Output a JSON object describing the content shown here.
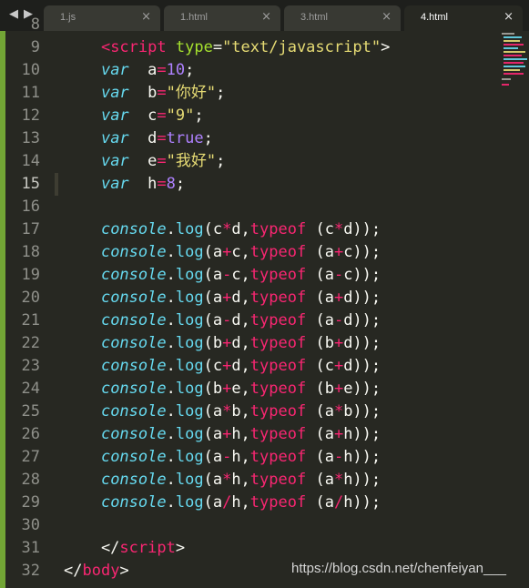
{
  "tabs": [
    {
      "label": "1.js",
      "active": false
    },
    {
      "label": "1.html",
      "active": false
    },
    {
      "label": "3.html",
      "active": false
    },
    {
      "label": "4.html",
      "active": true
    }
  ],
  "close_glyph": "×",
  "nav": {
    "back": "◀",
    "forward": "▶"
  },
  "line_numbers": [
    "8",
    "9",
    "10",
    "11",
    "12",
    "13",
    "14",
    "15",
    "16",
    "17",
    "18",
    "19",
    "20",
    "21",
    "22",
    "23",
    "24",
    "25",
    "26",
    "27",
    "28",
    "29",
    "30",
    "31",
    "32"
  ],
  "current_line": "15",
  "code_lines": [
    [
      [
        "plain",
        "    "
      ],
      [
        "tag",
        "<script"
      ],
      [
        "plain",
        " "
      ],
      [
        "attr",
        "type"
      ],
      [
        "plain",
        "="
      ],
      [
        "str",
        "\"text/javascript\""
      ],
      [
        "plain",
        ">"
      ]
    ],
    [
      [
        "plain",
        "    "
      ],
      [
        "kw",
        "var"
      ],
      [
        "plain",
        "  a"
      ],
      [
        "op",
        "="
      ],
      [
        "num",
        "10"
      ],
      [
        "plain",
        ";"
      ]
    ],
    [
      [
        "plain",
        "    "
      ],
      [
        "kw",
        "var"
      ],
      [
        "plain",
        "  b"
      ],
      [
        "op",
        "="
      ],
      [
        "str",
        "\"你好\""
      ],
      [
        "plain",
        ";"
      ]
    ],
    [
      [
        "plain",
        "    "
      ],
      [
        "kw",
        "var"
      ],
      [
        "plain",
        "  c"
      ],
      [
        "op",
        "="
      ],
      [
        "str",
        "\"9\""
      ],
      [
        "plain",
        ";"
      ]
    ],
    [
      [
        "plain",
        "    "
      ],
      [
        "kw",
        "var"
      ],
      [
        "plain",
        "  d"
      ],
      [
        "op",
        "="
      ],
      [
        "num",
        "true"
      ],
      [
        "plain",
        ";"
      ]
    ],
    [
      [
        "plain",
        "    "
      ],
      [
        "kw",
        "var"
      ],
      [
        "plain",
        "  e"
      ],
      [
        "op",
        "="
      ],
      [
        "str",
        "\"我好\""
      ],
      [
        "plain",
        ";"
      ]
    ],
    [
      [
        "plain",
        "    "
      ],
      [
        "kw",
        "var"
      ],
      [
        "plain",
        "  h"
      ],
      [
        "op",
        "="
      ],
      [
        "num",
        "8"
      ],
      [
        "plain",
        ";"
      ]
    ],
    [],
    [
      [
        "plain",
        "    "
      ],
      [
        "obj",
        "console"
      ],
      [
        "plain",
        "."
      ],
      [
        "fn",
        "log"
      ],
      [
        "plain",
        "(c"
      ],
      [
        "op",
        "*"
      ],
      [
        "plain",
        "d,"
      ],
      [
        "op",
        "typeof"
      ],
      [
        "plain",
        " (c"
      ],
      [
        "op",
        "*"
      ],
      [
        "plain",
        "d));"
      ]
    ],
    [
      [
        "plain",
        "    "
      ],
      [
        "obj",
        "console"
      ],
      [
        "plain",
        "."
      ],
      [
        "fn",
        "log"
      ],
      [
        "plain",
        "(a"
      ],
      [
        "op",
        "+"
      ],
      [
        "plain",
        "c,"
      ],
      [
        "op",
        "typeof"
      ],
      [
        "plain",
        " (a"
      ],
      [
        "op",
        "+"
      ],
      [
        "plain",
        "c));"
      ]
    ],
    [
      [
        "plain",
        "    "
      ],
      [
        "obj",
        "console"
      ],
      [
        "plain",
        "."
      ],
      [
        "fn",
        "log"
      ],
      [
        "plain",
        "(a"
      ],
      [
        "op",
        "-"
      ],
      [
        "plain",
        "c,"
      ],
      [
        "op",
        "typeof"
      ],
      [
        "plain",
        " (a"
      ],
      [
        "op",
        "-"
      ],
      [
        "plain",
        "c));"
      ]
    ],
    [
      [
        "plain",
        "    "
      ],
      [
        "obj",
        "console"
      ],
      [
        "plain",
        "."
      ],
      [
        "fn",
        "log"
      ],
      [
        "plain",
        "(a"
      ],
      [
        "op",
        "+"
      ],
      [
        "plain",
        "d,"
      ],
      [
        "op",
        "typeof"
      ],
      [
        "plain",
        " (a"
      ],
      [
        "op",
        "+"
      ],
      [
        "plain",
        "d));"
      ]
    ],
    [
      [
        "plain",
        "    "
      ],
      [
        "obj",
        "console"
      ],
      [
        "plain",
        "."
      ],
      [
        "fn",
        "log"
      ],
      [
        "plain",
        "(a"
      ],
      [
        "op",
        "-"
      ],
      [
        "plain",
        "d,"
      ],
      [
        "op",
        "typeof"
      ],
      [
        "plain",
        " (a"
      ],
      [
        "op",
        "-"
      ],
      [
        "plain",
        "d));"
      ]
    ],
    [
      [
        "plain",
        "    "
      ],
      [
        "obj",
        "console"
      ],
      [
        "plain",
        "."
      ],
      [
        "fn",
        "log"
      ],
      [
        "plain",
        "(b"
      ],
      [
        "op",
        "+"
      ],
      [
        "plain",
        "d,"
      ],
      [
        "op",
        "typeof"
      ],
      [
        "plain",
        " (b"
      ],
      [
        "op",
        "+"
      ],
      [
        "plain",
        "d));"
      ]
    ],
    [
      [
        "plain",
        "    "
      ],
      [
        "obj",
        "console"
      ],
      [
        "plain",
        "."
      ],
      [
        "fn",
        "log"
      ],
      [
        "plain",
        "(c"
      ],
      [
        "op",
        "+"
      ],
      [
        "plain",
        "d,"
      ],
      [
        "op",
        "typeof"
      ],
      [
        "plain",
        " (c"
      ],
      [
        "op",
        "+"
      ],
      [
        "plain",
        "d));"
      ]
    ],
    [
      [
        "plain",
        "    "
      ],
      [
        "obj",
        "console"
      ],
      [
        "plain",
        "."
      ],
      [
        "fn",
        "log"
      ],
      [
        "plain",
        "(b"
      ],
      [
        "op",
        "+"
      ],
      [
        "plain",
        "e,"
      ],
      [
        "op",
        "typeof"
      ],
      [
        "plain",
        " (b"
      ],
      [
        "op",
        "+"
      ],
      [
        "plain",
        "e));"
      ]
    ],
    [
      [
        "plain",
        "    "
      ],
      [
        "obj",
        "console"
      ],
      [
        "plain",
        "."
      ],
      [
        "fn",
        "log"
      ],
      [
        "plain",
        "(a"
      ],
      [
        "op",
        "*"
      ],
      [
        "plain",
        "b,"
      ],
      [
        "op",
        "typeof"
      ],
      [
        "plain",
        " (a"
      ],
      [
        "op",
        "*"
      ],
      [
        "plain",
        "b));"
      ]
    ],
    [
      [
        "plain",
        "    "
      ],
      [
        "obj",
        "console"
      ],
      [
        "plain",
        "."
      ],
      [
        "fn",
        "log"
      ],
      [
        "plain",
        "(a"
      ],
      [
        "op",
        "+"
      ],
      [
        "plain",
        "h,"
      ],
      [
        "op",
        "typeof"
      ],
      [
        "plain",
        " (a"
      ],
      [
        "op",
        "+"
      ],
      [
        "plain",
        "h));"
      ]
    ],
    [
      [
        "plain",
        "    "
      ],
      [
        "obj",
        "console"
      ],
      [
        "plain",
        "."
      ],
      [
        "fn",
        "log"
      ],
      [
        "plain",
        "(a"
      ],
      [
        "op",
        "-"
      ],
      [
        "plain",
        "h,"
      ],
      [
        "op",
        "typeof"
      ],
      [
        "plain",
        " (a"
      ],
      [
        "op",
        "-"
      ],
      [
        "plain",
        "h));"
      ]
    ],
    [
      [
        "plain",
        "    "
      ],
      [
        "obj",
        "console"
      ],
      [
        "plain",
        "."
      ],
      [
        "fn",
        "log"
      ],
      [
        "plain",
        "(a"
      ],
      [
        "op",
        "*"
      ],
      [
        "plain",
        "h,"
      ],
      [
        "op",
        "typeof"
      ],
      [
        "plain",
        " (a"
      ],
      [
        "op",
        "*"
      ],
      [
        "plain",
        "h));"
      ]
    ],
    [
      [
        "plain",
        "    "
      ],
      [
        "obj",
        "console"
      ],
      [
        "plain",
        "."
      ],
      [
        "fn",
        "log"
      ],
      [
        "plain",
        "(a"
      ],
      [
        "op",
        "/"
      ],
      [
        "plain",
        "h,"
      ],
      [
        "op",
        "typeof"
      ],
      [
        "plain",
        " (a"
      ],
      [
        "op",
        "/"
      ],
      [
        "plain",
        "h));"
      ]
    ],
    [],
    [
      [
        "plain",
        "    </"
      ],
      [
        "tag",
        "script"
      ],
      [
        "plain",
        ">"
      ]
    ],
    [
      [
        "plain",
        "</"
      ],
      [
        "tag",
        "body"
      ],
      [
        "plain",
        ">"
      ]
    ]
  ],
  "watermark": "https://blog.csdn.net/chenfeiyan___",
  "colors": {
    "background": "#272822",
    "gutter_accent": "#72a535",
    "keyword": "#66d9ef",
    "operator": "#f92672",
    "string": "#e6db74",
    "number": "#ae81ff",
    "attribute": "#a6e22e"
  }
}
